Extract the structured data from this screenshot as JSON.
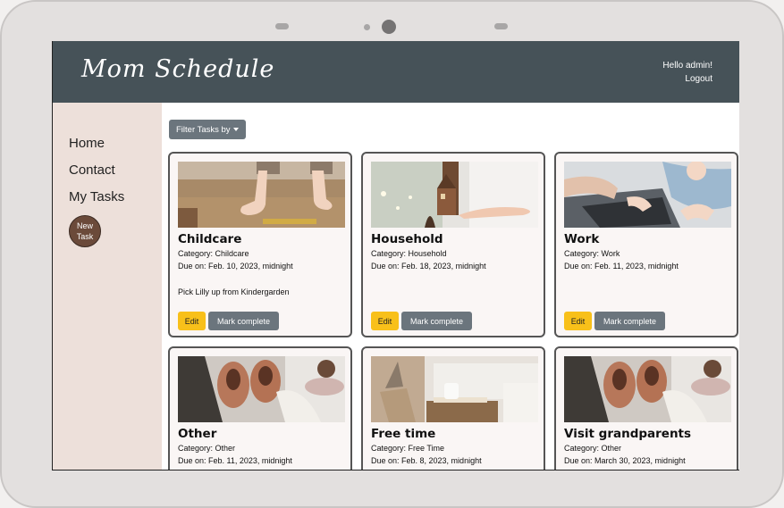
{
  "header": {
    "brand": "Mom Schedule",
    "greeting": "Hello admin!",
    "logout": "Logout"
  },
  "sidebar": {
    "items": [
      {
        "label": "Home"
      },
      {
        "label": "Contact"
      },
      {
        "label": "My Tasks"
      }
    ],
    "new_task": "New Task"
  },
  "toolbar": {
    "filter_label": "Filter Tasks by"
  },
  "tasks": [
    {
      "title": "Childcare",
      "category": "Category: Childcare",
      "due": "Due on: Feb. 10, 2023, midnight",
      "description": "Pick Lilly up from Kindergarden",
      "edit": "Edit",
      "complete": "Mark complete"
    },
    {
      "title": "Household",
      "category": "Category: Household",
      "due": "Due on: Feb. 18, 2023, midnight",
      "description": "",
      "edit": "Edit",
      "complete": "Mark complete"
    },
    {
      "title": "Work",
      "category": "Category: Work",
      "due": "Due on: Feb. 11, 2023, midnight",
      "description": "",
      "edit": "Edit",
      "complete": "Mark complete"
    },
    {
      "title": "Other",
      "category": "Category: Other",
      "due": "Due on: Feb. 11, 2023, midnight"
    },
    {
      "title": "Free time",
      "category": "Category: Free Time",
      "due": "Due on: Feb. 8, 2023, midnight"
    },
    {
      "title": "Visit grandparents",
      "category": "Category: Other",
      "due": "Due on: March 30, 2023, midnight"
    }
  ],
  "colors": {
    "topbar": "#465258",
    "sidebar": "#ede0da",
    "edit_button": "#f8c01a",
    "secondary_button": "#6b757d"
  }
}
